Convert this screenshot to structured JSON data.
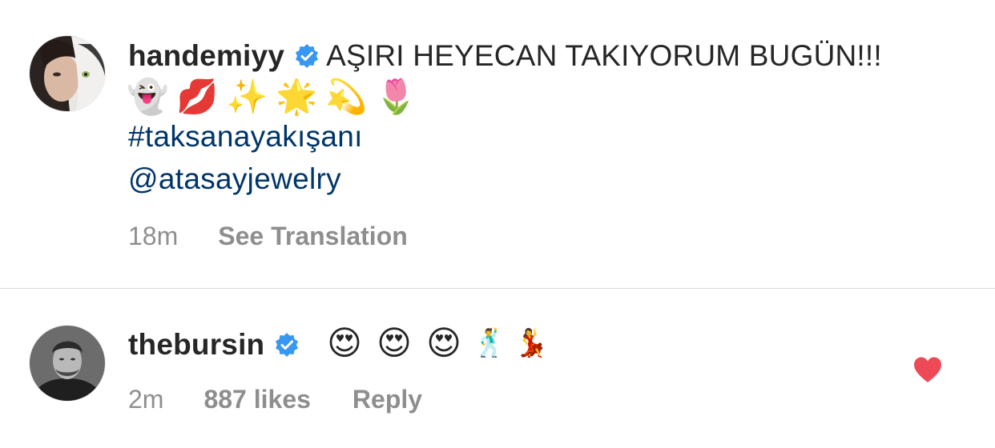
{
  "comments": [
    {
      "username": "handemiyy",
      "verified": true,
      "text": "AŞIRI HEYECAN TAKIYORUM BUGÜN!!!",
      "emojis": [
        "👻",
        "💋",
        "✨",
        "🌟",
        "💫",
        "🌷"
      ],
      "hashtag": "#taksanayakışanı",
      "mention": "@atasayjewelry",
      "time": "18m",
      "action": "See Translation"
    },
    {
      "username": "thebursin",
      "verified": true,
      "emojis": [
        "😍",
        "😍",
        "😍",
        "🕺",
        "💃"
      ],
      "time": "2m",
      "likes": "887 likes",
      "action": "Reply",
      "liked": true
    }
  ],
  "icons": {
    "verified": "verified-badge-icon",
    "like": "heart-icon"
  },
  "colors": {
    "verified_blue": "#3897f0",
    "link_blue": "#003569",
    "meta_gray": "#8e8e8e",
    "heart_red": "#ed4956",
    "divider": "#dbdbdb"
  }
}
